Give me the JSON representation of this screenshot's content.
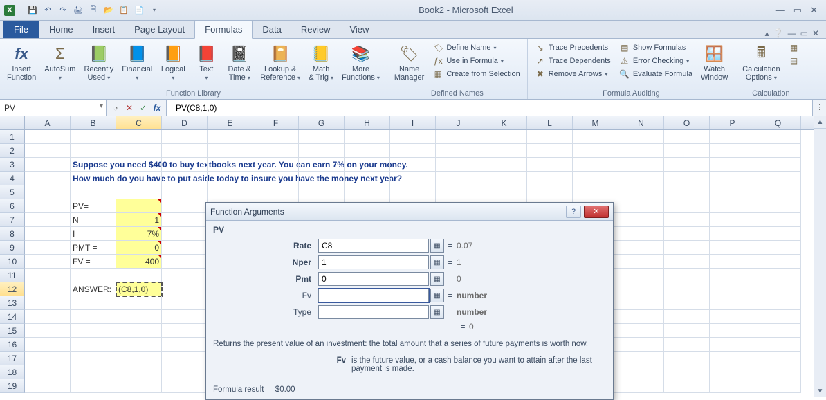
{
  "window": {
    "title": "Book2 - Microsoft Excel"
  },
  "tabs": {
    "file": "File",
    "items": [
      "Home",
      "Insert",
      "Page Layout",
      "Formulas",
      "Data",
      "Review",
      "View"
    ],
    "active": "Formulas"
  },
  "ribbon": {
    "groups": {
      "func_lib": "Function Library",
      "defined": "Defined Names",
      "audit": "Formula Auditing",
      "calc": "Calculation"
    },
    "buttons": {
      "insert_fn": "Insert\nFunction",
      "autosum": "AutoSum",
      "recent": "Recently\nUsed",
      "financial": "Financial",
      "logical": "Logical",
      "text": "Text",
      "datetime": "Date &\nTime",
      "lookup": "Lookup &\nReference",
      "math": "Math\n& Trig",
      "more": "More\nFunctions",
      "name_mgr": "Name\nManager",
      "define_name": "Define Name",
      "use_formula": "Use in Formula",
      "create_sel": "Create from Selection",
      "trace_prec": "Trace Precedents",
      "trace_dep": "Trace Dependents",
      "remove_arr": "Remove Arrows",
      "show_form": "Show Formulas",
      "err_check": "Error Checking",
      "eval_form": "Evaluate Formula",
      "watch": "Watch\nWindow",
      "calc_opt": "Calculation\nOptions"
    }
  },
  "fbar": {
    "namebox": "PV",
    "formula": "=PV(C8,1,0)"
  },
  "columns": [
    "A",
    "B",
    "C",
    "D",
    "E",
    "F",
    "G",
    "H",
    "I",
    "J",
    "K",
    "L",
    "M",
    "N",
    "O",
    "P",
    "Q"
  ],
  "rownums": [
    "1",
    "2",
    "3",
    "4",
    "5",
    "6",
    "7",
    "8",
    "9",
    "10",
    "11",
    "12",
    "13",
    "14",
    "15",
    "16",
    "17",
    "18",
    "19"
  ],
  "sheet": {
    "r3": "Suppose you need $400 to buy textbooks next year.  You can earn 7% on your money.",
    "r4": "How much do you have to put aside today to insure you have the money next year?",
    "b6": "PV=",
    "b7": "N =",
    "c7": "1",
    "b8": "I =",
    "c8": "7%",
    "b9": "PMT =",
    "c9": "0",
    "b10": "FV =",
    "c10": "400",
    "b12": "ANSWER:",
    "c12": "(C8,1,0)"
  },
  "dialog": {
    "title": "Function Arguments",
    "fn": "PV",
    "args": [
      {
        "label": "Rate",
        "input": "C8",
        "val": "0.07"
      },
      {
        "label": "Nper",
        "input": "1",
        "val": "1"
      },
      {
        "label": "Pmt",
        "input": "0",
        "val": "0"
      },
      {
        "label": "Fv",
        "input": "",
        "val": "number"
      },
      {
        "label": "Type",
        "input": "",
        "val": "number"
      }
    ],
    "result_eq": "= 0",
    "desc": "Returns the present value of an investment: the total amount that a series of future payments is worth now.",
    "arg_help_name": "Fv",
    "arg_help_text": "is the future value, or a cash balance you want to attain after the last payment is made.",
    "formula_result_label": "Formula result =",
    "formula_result_val": "$0.00"
  },
  "chart_data": {
    "type": "table",
    "title": "PV worksheet inputs",
    "rows": [
      {
        "label": "PV=",
        "value": ""
      },
      {
        "label": "N =",
        "value": 1
      },
      {
        "label": "I =",
        "value": "7%"
      },
      {
        "label": "PMT =",
        "value": 0
      },
      {
        "label": "FV =",
        "value": 400
      }
    ],
    "formula": "=PV(C8,1,0)",
    "function_args": {
      "Rate": "C8 → 0.07",
      "Nper": 1,
      "Pmt": 0,
      "Fv": "",
      "Type": ""
    }
  }
}
